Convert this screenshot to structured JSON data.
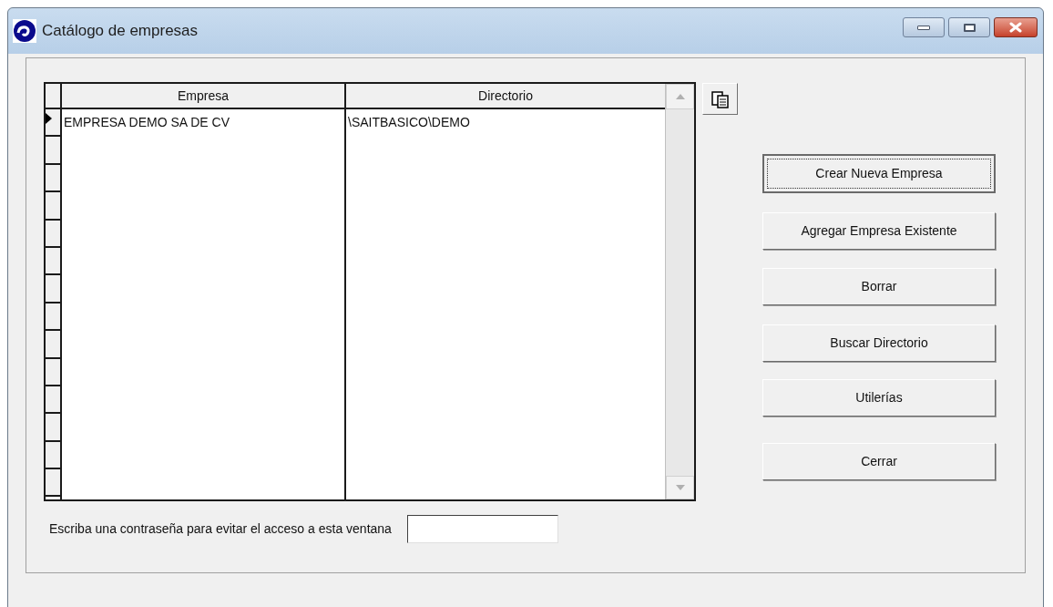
{
  "window": {
    "title": "Catálogo de empresas"
  },
  "table": {
    "columns": [
      "Empresa",
      "Directorio"
    ],
    "rows": [
      {
        "cells": [
          "EMPRESA DEMO SA DE CV",
          "\\SAITBASICO\\DEMO"
        ],
        "selected": true
      }
    ]
  },
  "buttons": [
    {
      "label": "Crear Nueva Empresa",
      "focused": true
    },
    {
      "label": "Agregar Empresa Existente",
      "focused": false
    },
    {
      "label": "Borrar",
      "focused": false
    },
    {
      "label": "Buscar Directorio",
      "focused": false
    },
    {
      "label": "Utilerías",
      "focused": false
    },
    {
      "label": "Cerrar",
      "focused": false
    }
  ],
  "password": {
    "label": "Escriba una contraseña para evitar el acceso a esta ventana"
  }
}
